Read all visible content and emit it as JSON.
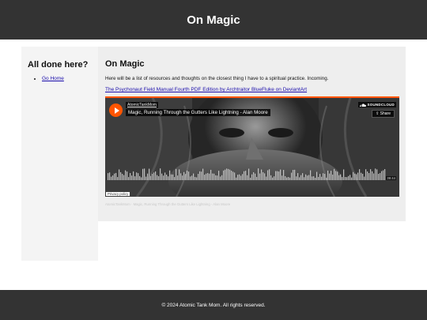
{
  "header": {
    "title": "On Magic"
  },
  "sidebar": {
    "heading": "All done here?",
    "links": [
      {
        "label": "Go Home"
      }
    ]
  },
  "main": {
    "title": "On Magic",
    "intro": "Here will be a list of resources and thoughts on the closest thing I have to a spiritual practice. Incoming.",
    "link_text": "The Psychonaut Field Manual Fourth PDF Edition by Archtraitor BlueFluke on DeviantArt"
  },
  "player": {
    "artist": "AtomicTankMom",
    "track_title": "Magic, Running Through the Gutters Like Lightning - Alan Moore",
    "brand": "SOUNDCLOUD",
    "share_label": "Share",
    "duration": "39:44",
    "privacy_label": "Privacy policy",
    "caption": "AtomicTankMom · Magic, Running Through the Gutters Like Lightning - Alan Moore",
    "colors": {
      "accent": "#ff5500",
      "background": "#2a2a2a"
    },
    "icons": {
      "play": "play-icon",
      "brand": "soundcloud-cloud-icon",
      "share": "share-icon"
    }
  },
  "footer": {
    "text": "© 2024 Atomic Tank Mom. All rights reserved."
  }
}
